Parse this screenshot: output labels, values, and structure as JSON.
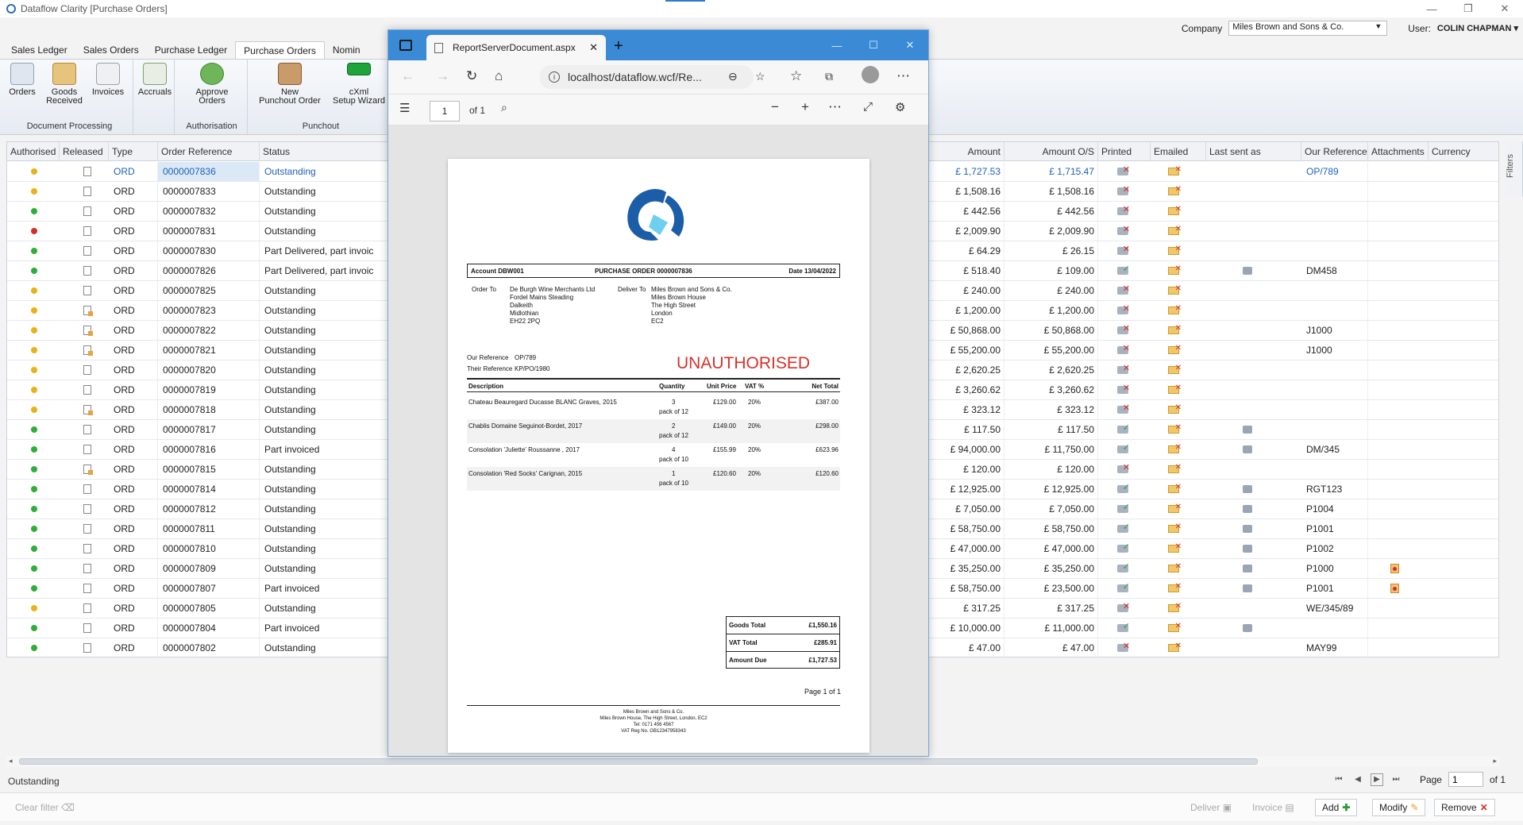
{
  "app": {
    "title": "Dataflow Clarity [Purchase Orders]",
    "company_label": "Company",
    "company_value": "Miles Brown and Sons & Co.",
    "user_label": "User:",
    "user_value": "COLIN CHAPMAN"
  },
  "tabs": [
    "Sales Ledger",
    "Sales Orders",
    "Purchase Ledger",
    "Purchase Orders",
    "Nomin"
  ],
  "ribbon": {
    "groups": [
      {
        "label": "Document Processing"
      },
      {
        "label": "Authorisation"
      },
      {
        "label": "Punchout"
      }
    ],
    "buttons": {
      "orders": "Orders",
      "goods_1": "Goods",
      "goods_2": "Received",
      "invoices": "Invoices",
      "accruals": "Accruals",
      "approve_1": "Approve",
      "approve_2": "Orders",
      "new_1": "New",
      "new_2": "Punchout Order",
      "cxml_1": "cXml",
      "cxml_2": "Setup Wizard"
    }
  },
  "grid": {
    "headers": {
      "authorised": "Authorised",
      "released": "Released",
      "type": "Type",
      "order_ref": "Order Reference",
      "status": "Status",
      "amount": "Amount",
      "amount_os": "Amount O/S",
      "printed": "Printed",
      "emailed": "Emailed",
      "last_sent": "Last sent as",
      "our_ref": "Our Reference",
      "attachments": "Attachments",
      "currency": "Currency"
    },
    "rows": [
      {
        "auth": "#e8b21a",
        "rel": "plain",
        "type": "ORD",
        "ref": "0000007836",
        "status": "Outstanding",
        "amount": "£ 1,727.53",
        "os": "£ 1,715.47",
        "printed": "x",
        "last": false,
        "ourref": "OP/789",
        "attach": false
      },
      {
        "auth": "#e8b21a",
        "rel": "plain",
        "type": "ORD",
        "ref": "0000007833",
        "status": "Outstanding",
        "amount": "£ 1,508.16",
        "os": "£ 1,508.16",
        "printed": "x",
        "last": false,
        "ourref": "",
        "attach": false
      },
      {
        "auth": "#2fae3a",
        "rel": "plain",
        "type": "ORD",
        "ref": "0000007832",
        "status": "Outstanding",
        "amount": "£ 442.56",
        "os": "£ 442.56",
        "printed": "x",
        "last": false,
        "ourref": "",
        "attach": false
      },
      {
        "auth": "#d0302a",
        "rel": "plain",
        "type": "ORD",
        "ref": "0000007831",
        "status": "Outstanding",
        "amount": "£ 2,009.90",
        "os": "£ 2,009.90",
        "printed": "x",
        "last": false,
        "ourref": "",
        "attach": false
      },
      {
        "auth": "#2fae3a",
        "rel": "plain",
        "type": "ORD",
        "ref": "0000007830",
        "status": "Part Delivered, part invoic",
        "amount": "£ 64.29",
        "os": "£ 26.15",
        "printed": "x",
        "last": false,
        "ourref": "",
        "attach": false
      },
      {
        "auth": "#2fae3a",
        "rel": "plain",
        "type": "ORD",
        "ref": "0000007826",
        "status": "Part Delivered, part invoic",
        "amount": "£ 518.40",
        "os": "£ 109.00",
        "printed": "ok",
        "last": true,
        "ourref": "DM458",
        "attach": false
      },
      {
        "auth": "#e8b21a",
        "rel": "plain",
        "type": "ORD",
        "ref": "0000007825",
        "status": "Outstanding",
        "amount": "£ 240.00",
        "os": "£ 240.00",
        "printed": "x",
        "last": false,
        "ourref": "",
        "attach": false
      },
      {
        "auth": "#e8b21a",
        "rel": "warn",
        "type": "ORD",
        "ref": "0000007823",
        "status": "Outstanding",
        "amount": "£ 1,200.00",
        "os": "£ 1,200.00",
        "printed": "x",
        "last": false,
        "ourref": "",
        "attach": false
      },
      {
        "auth": "#e8b21a",
        "rel": "warn",
        "type": "ORD",
        "ref": "0000007822",
        "status": "Outstanding",
        "amount": "£ 50,868.00",
        "os": "£ 50,868.00",
        "printed": "x",
        "last": false,
        "ourref": "J1000",
        "attach": false
      },
      {
        "auth": "#e8b21a",
        "rel": "warn",
        "type": "ORD",
        "ref": "0000007821",
        "status": "Outstanding",
        "amount": "£ 55,200.00",
        "os": "£ 55,200.00",
        "printed": "x",
        "last": false,
        "ourref": "J1000",
        "attach": false
      },
      {
        "auth": "#e8b21a",
        "rel": "plain",
        "type": "ORD",
        "ref": "0000007820",
        "status": "Outstanding",
        "amount": "£ 2,620.25",
        "os": "£ 2,620.25",
        "printed": "x",
        "last": false,
        "ourref": "",
        "attach": false
      },
      {
        "auth": "#e8b21a",
        "rel": "plain",
        "type": "ORD",
        "ref": "0000007819",
        "status": "Outstanding",
        "amount": "£ 3,260.62",
        "os": "£ 3,260.62",
        "printed": "x",
        "last": false,
        "ourref": "",
        "attach": false
      },
      {
        "auth": "#e8b21a",
        "rel": "warn",
        "type": "ORD",
        "ref": "0000007818",
        "status": "Outstanding",
        "amount": "£ 323.12",
        "os": "£ 323.12",
        "printed": "x",
        "last": false,
        "ourref": "",
        "attach": false
      },
      {
        "auth": "#2fae3a",
        "rel": "plain",
        "type": "ORD",
        "ref": "0000007817",
        "status": "Outstanding",
        "amount": "£ 117.50",
        "os": "£ 117.50",
        "printed": "ok",
        "last": true,
        "ourref": "",
        "attach": false
      },
      {
        "auth": "#2fae3a",
        "rel": "plain",
        "type": "ORD",
        "ref": "0000007816",
        "status": "Part invoiced",
        "amount": "£ 94,000.00",
        "os": "£ 11,750.00",
        "printed": "ok",
        "last": true,
        "ourref": "DM/345",
        "attach": false
      },
      {
        "auth": "#2fae3a",
        "rel": "warn",
        "type": "ORD",
        "ref": "0000007815",
        "status": "Outstanding",
        "amount": "£ 120.00",
        "os": "£ 120.00",
        "printed": "x",
        "last": false,
        "ourref": "",
        "attach": false
      },
      {
        "auth": "#2fae3a",
        "rel": "plain",
        "type": "ORD",
        "ref": "0000007814",
        "status": "Outstanding",
        "amount": "£ 12,925.00",
        "os": "£ 12,925.00",
        "printed": "ok",
        "last": true,
        "ourref": "RGT123",
        "attach": false
      },
      {
        "auth": "#2fae3a",
        "rel": "plain",
        "type": "ORD",
        "ref": "0000007812",
        "status": "Outstanding",
        "amount": "£ 7,050.00",
        "os": "£ 7,050.00",
        "printed": "ok",
        "last": true,
        "ourref": "P1004",
        "attach": false
      },
      {
        "auth": "#2fae3a",
        "rel": "plain",
        "type": "ORD",
        "ref": "0000007811",
        "status": "Outstanding",
        "amount": "£ 58,750.00",
        "os": "£ 58,750.00",
        "printed": "ok",
        "last": true,
        "ourref": "P1001",
        "attach": false
      },
      {
        "auth": "#2fae3a",
        "rel": "plain",
        "type": "ORD",
        "ref": "0000007810",
        "status": "Outstanding",
        "amount": "£ 47,000.00",
        "os": "£ 47,000.00",
        "printed": "ok",
        "last": true,
        "ourref": "P1002",
        "attach": false
      },
      {
        "auth": "#2fae3a",
        "rel": "plain",
        "type": "ORD",
        "ref": "0000007809",
        "status": "Outstanding",
        "amount": "£ 35,250.00",
        "os": "£ 35,250.00",
        "printed": "ok",
        "last": true,
        "ourref": "P1000",
        "attach": true
      },
      {
        "auth": "#2fae3a",
        "rel": "plain",
        "type": "ORD",
        "ref": "0000007807",
        "status": "Part invoiced",
        "amount": "£ 58,750.00",
        "os": "£ 23,500.00",
        "printed": "ok",
        "last": true,
        "ourref": "P1001",
        "attach": true
      },
      {
        "auth": "#e8b21a",
        "rel": "plain",
        "type": "ORD",
        "ref": "0000007805",
        "status": "Outstanding",
        "amount": "£ 317.25",
        "os": "£ 317.25",
        "printed": "x",
        "last": false,
        "ourref": "WE/345/89",
        "attach": false
      },
      {
        "auth": "#2fae3a",
        "rel": "plain",
        "type": "ORD",
        "ref": "0000007804",
        "status": "Part invoiced",
        "amount": "£ 10,000.00",
        "os": "£ 11,000.00",
        "printed": "ok",
        "last": true,
        "ourref": "",
        "attach": false
      },
      {
        "auth": "#2fae3a",
        "rel": "plain",
        "type": "ORD",
        "ref": "0000007802",
        "status": "Outstanding",
        "amount": "£ 47.00",
        "os": "£ 47.00",
        "printed": "x",
        "last": false,
        "ourref": "MAY99",
        "attach": false
      }
    ]
  },
  "status_bar": {
    "filter_text": "Outstanding",
    "page_label": "Page",
    "page_value": "1",
    "page_of": "of 1"
  },
  "bottom_bar": {
    "clear_filter": "Clear filter",
    "deliver": "Deliver",
    "invoice": "Invoice",
    "add": "Add",
    "modify": "Modify",
    "remove": "Remove"
  },
  "side_panel": {
    "filters": "Filters"
  },
  "browser": {
    "tab_title": "ReportServerDocument.aspx",
    "address": "localhost/dataflow.wcf/Re...",
    "pdf_page": "1",
    "pdf_of": "of 1"
  },
  "document": {
    "account": "Account DBW001",
    "po": "PURCHASE ORDER 0000007836",
    "date": "Date 13/04/2022",
    "order_to_label": "Order To",
    "order_to": [
      "De Burgh Wine Merchants Ltd",
      "Fordel Mains Steading",
      "Dalkeith",
      "Midlothian",
      "EH22 2PQ"
    ],
    "deliver_to_label": "Deliver To",
    "deliver_to": [
      "Miles Brown and Sons & Co.",
      "Miles Brown House",
      "The High Street",
      "London",
      "EC2"
    ],
    "our_ref_label": "Our Reference",
    "our_ref": "OP/789",
    "their_ref_label": "Their Reference",
    "their_ref": "KP/PO/1980",
    "watermark": "UNAUTHORISED",
    "col_description": "Description",
    "col_quantity": "Quantity",
    "col_unit_price": "Unit Price",
    "col_vat": "VAT %",
    "col_net": "Net Total",
    "lines": [
      {
        "desc": "Chateau Beauregard Ducasse BLANC Graves, 2015",
        "qty": "3",
        "pack": "pack of 12",
        "price": "£129.00",
        "vat": "20%",
        "net": "£387.00"
      },
      {
        "desc": "Chablis Domaine Seguinot-Bordet, 2017",
        "qty": "2",
        "pack": "pack of 12",
        "price": "£149.00",
        "vat": "20%",
        "net": "£298.00"
      },
      {
        "desc": "Consolation 'Juliette' Roussanne , 2017",
        "qty": "4",
        "pack": "pack of 10",
        "price": "£155.99",
        "vat": "20%",
        "net": "£623.96"
      },
      {
        "desc": "Consolation 'Red Socks' Carignan, 2015",
        "qty": "1",
        "pack": "pack of 10",
        "price": "£120.60",
        "vat": "20%",
        "net": "£120.60"
      }
    ],
    "goods_total_label": "Goods Total",
    "goods_total": "£1,550.16",
    "vat_total_label": "VAT Total",
    "vat_total": "£285.91",
    "amount_due_label": "Amount Due",
    "amount_due": "£1,727.53",
    "page_of": "Page 1 of 1",
    "footer": [
      "Miles Brown and Sons & Co.",
      "Miles Brown House, The High Street, London, EC2",
      "Tel: 0171 456 4567",
      "VAT Reg No. GB12347958343"
    ]
  }
}
